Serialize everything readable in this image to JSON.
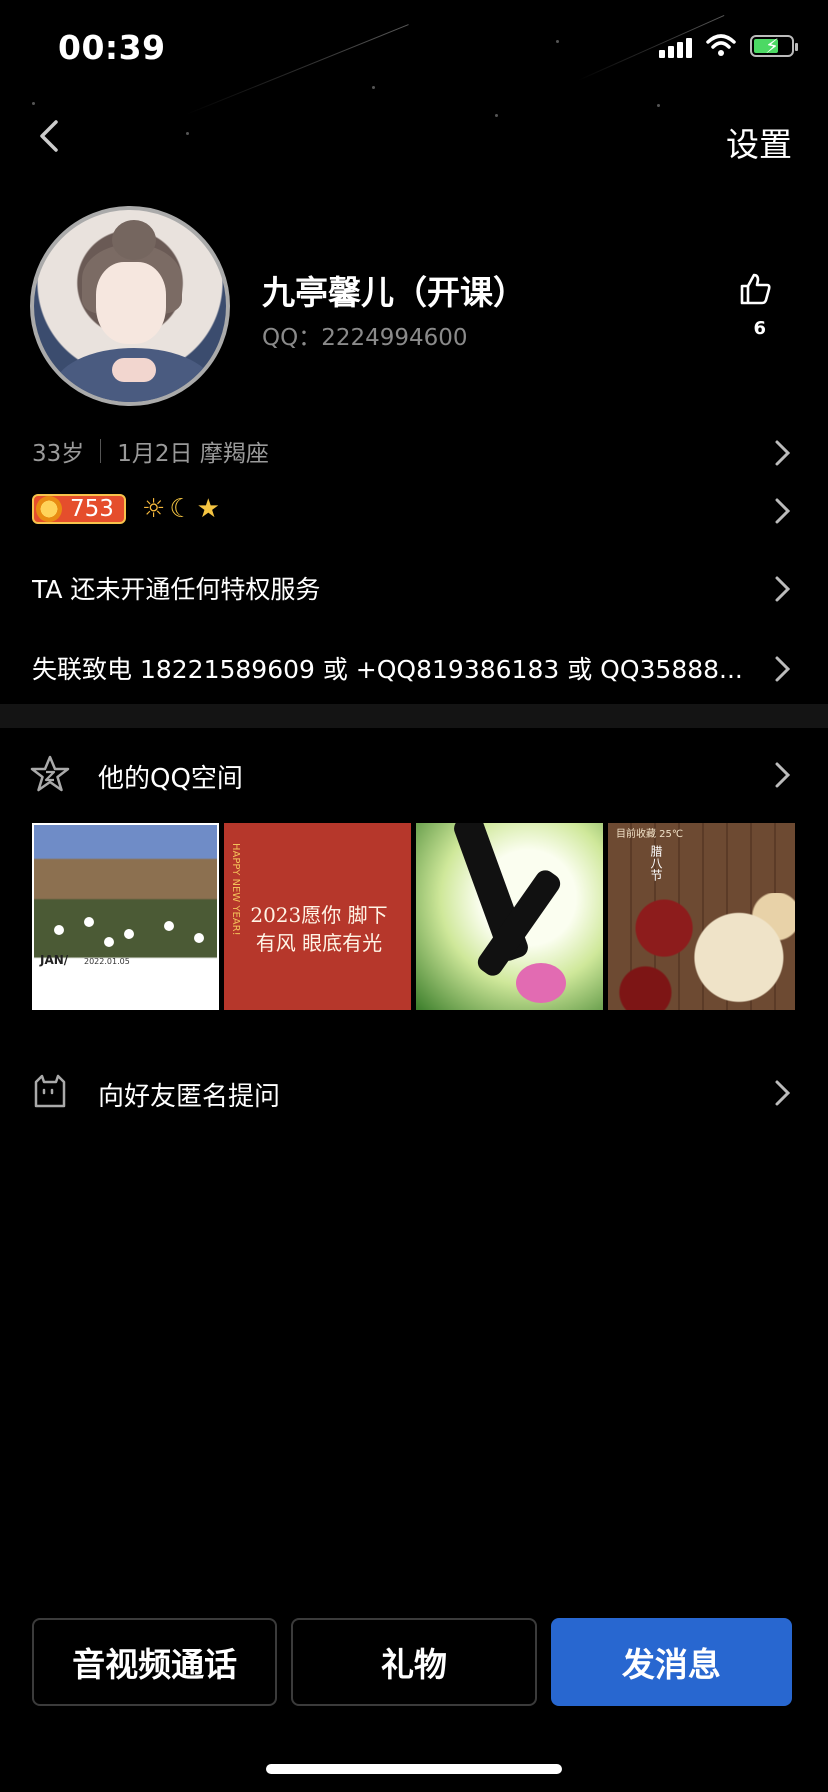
{
  "status_bar": {
    "time": "00:39"
  },
  "header": {
    "settings_label": "设置"
  },
  "profile": {
    "nickname": "九亭馨儿（开课）",
    "qq_line": "QQ：2224994600",
    "like_count": "6"
  },
  "info": {
    "age": "33岁",
    "birthday": "1月2日 摩羯座"
  },
  "level": {
    "value": "753",
    "icons": [
      "sun-icon",
      "moon-icon",
      "star-icon"
    ]
  },
  "rows": {
    "privilege": "TA 还未开通任何特权服务",
    "signature": "失联致电 18221589609 或 +QQ819386183 或 QQ35888..."
  },
  "qzone": {
    "label": "他的QQ空间",
    "photos": [
      {
        "caption": "JAN/",
        "date": "2022.01.05"
      },
      {
        "text": "2023愿你 脚下有风 眼底有光",
        "side": "HAPPY NEW YEAR!"
      },
      {},
      {
        "label": "目前收藏 25℃",
        "vertical": "腊八节"
      }
    ]
  },
  "ask": {
    "label": "向好友匿名提问"
  },
  "bottom_buttons": {
    "call": "音视频通话",
    "gift": "礼物",
    "message": "发消息"
  },
  "colors": {
    "background": "#000000",
    "primary_button": "#2867d0",
    "level_badge": "#e54e2c"
  }
}
